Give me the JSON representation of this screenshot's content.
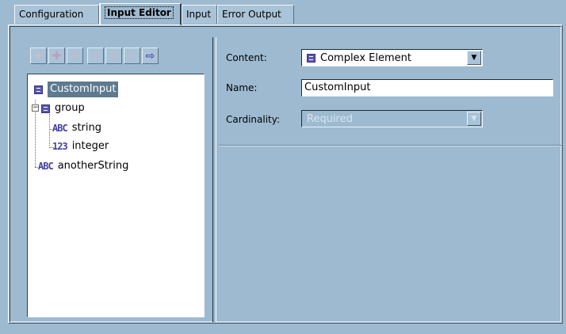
{
  "tabs": [
    {
      "label": "Configuration",
      "active": false
    },
    {
      "label": "Input Editor",
      "active": true
    },
    {
      "label": "Input",
      "active": false
    },
    {
      "label": "Error Output",
      "active": false
    }
  ],
  "toolbar": {
    "buttons": [
      {
        "name": "add-icon",
        "glyph": "✚",
        "enabled": false
      },
      {
        "name": "add-child-icon",
        "glyph": "✚",
        "enabled": false
      },
      {
        "name": "delete-icon",
        "glyph": "✕",
        "enabled": false
      },
      {
        "name": "move-up-icon",
        "glyph": "⇧",
        "enabled": false
      },
      {
        "name": "move-down-icon",
        "glyph": "⇩",
        "enabled": false
      },
      {
        "name": "move-left-icon",
        "glyph": "⇦",
        "enabled": false
      },
      {
        "name": "move-right-icon",
        "glyph": "⇨",
        "enabled": true
      }
    ]
  },
  "tree": {
    "nodes": [
      {
        "label": "CustomInput",
        "icon": "complex-element-icon",
        "selected": true
      },
      {
        "label": "group",
        "icon": "complex-element-icon",
        "selected": false
      },
      {
        "label": "string",
        "icon": "text-type-icon",
        "icon_text": "ABC",
        "selected": false
      },
      {
        "label": "integer",
        "icon": "integer-type-icon",
        "icon_text": "123",
        "selected": false
      },
      {
        "label": "anotherString",
        "icon": "text-type-icon",
        "icon_text": "ABC",
        "selected": false
      }
    ],
    "expander_glyph": "−"
  },
  "form": {
    "content_label": "Content:",
    "content_value": "Complex Element",
    "name_label": "Name:",
    "name_value": "CustomInput",
    "cardinality_label": "Cardinality:",
    "cardinality_value": "Required",
    "arrow_glyph": "▼"
  },
  "colors": {
    "background": "#9dbad0",
    "selection": "#5d7a91",
    "icon_purple": "#4340a0"
  }
}
